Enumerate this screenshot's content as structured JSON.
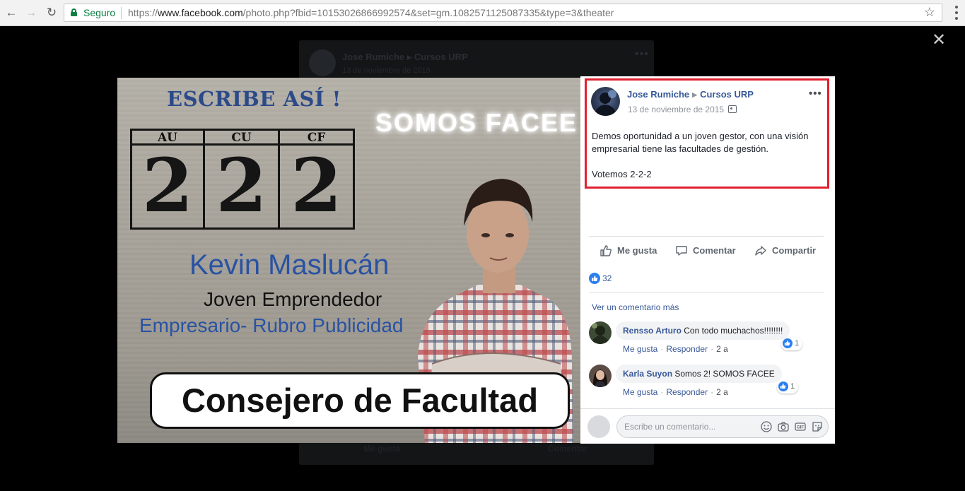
{
  "browser": {
    "secure_label": "Seguro",
    "url_scheme": "https://",
    "url_host": "www.facebook.com",
    "url_path": "/photo.php?fbid=10153026866992574&set=gm.1082571125087335&type=3&theater"
  },
  "background_post": {
    "author": "Jose Rumiche ▸ Cursos URP",
    "date": "13 de noviembre de 2015",
    "like_label": "Me gusta",
    "comment_label": "Comentar"
  },
  "photo": {
    "escribe": "ESCRIBE ASÍ !",
    "somos": "SOMOS FACEE",
    "ballot": [
      {
        "header": "AU",
        "number": "2"
      },
      {
        "header": "CU",
        "number": "2"
      },
      {
        "header": "CF",
        "number": "2"
      }
    ],
    "name": "Kevin Maslucán",
    "role": "Joven Emprendedor",
    "business": "Empresario- Rubro Publicidad",
    "banner": "Consejero de Facultad"
  },
  "post": {
    "author": "Jose Rumiche",
    "group": "Cursos URP",
    "date": "13 de noviembre de 2015",
    "text_1": "Demos oportunidad a un joven gestor, con una visión empresarial tiene las facultades de gestión.",
    "text_2": "Votemos 2-2-2",
    "highlight_color": "#e0202e"
  },
  "actions": {
    "like": "Me gusta",
    "comment": "Comentar",
    "share": "Compartir"
  },
  "reactions": {
    "count": "32"
  },
  "comments": {
    "more_label": "Ver un comentario más",
    "items": [
      {
        "name": "Rensso Arturo",
        "text": "Con todo muchachos!!!!!!!!",
        "like": "Me gusta",
        "reply": "Responder",
        "time": "2 a",
        "reactions": "1"
      },
      {
        "name": "Karla Suyon",
        "text": "Somos 2! SOMOS FACEE",
        "like": "Me gusta",
        "reply": "Responder",
        "time": "2 a",
        "reactions": "1"
      }
    ]
  },
  "comment_box": {
    "placeholder": "Escribe un comentario..."
  },
  "icons": {
    "close": "close-icon",
    "emoji": "emoji-icon",
    "camera": "camera-icon",
    "gif": "gif-icon",
    "sticker": "sticker-icon"
  }
}
